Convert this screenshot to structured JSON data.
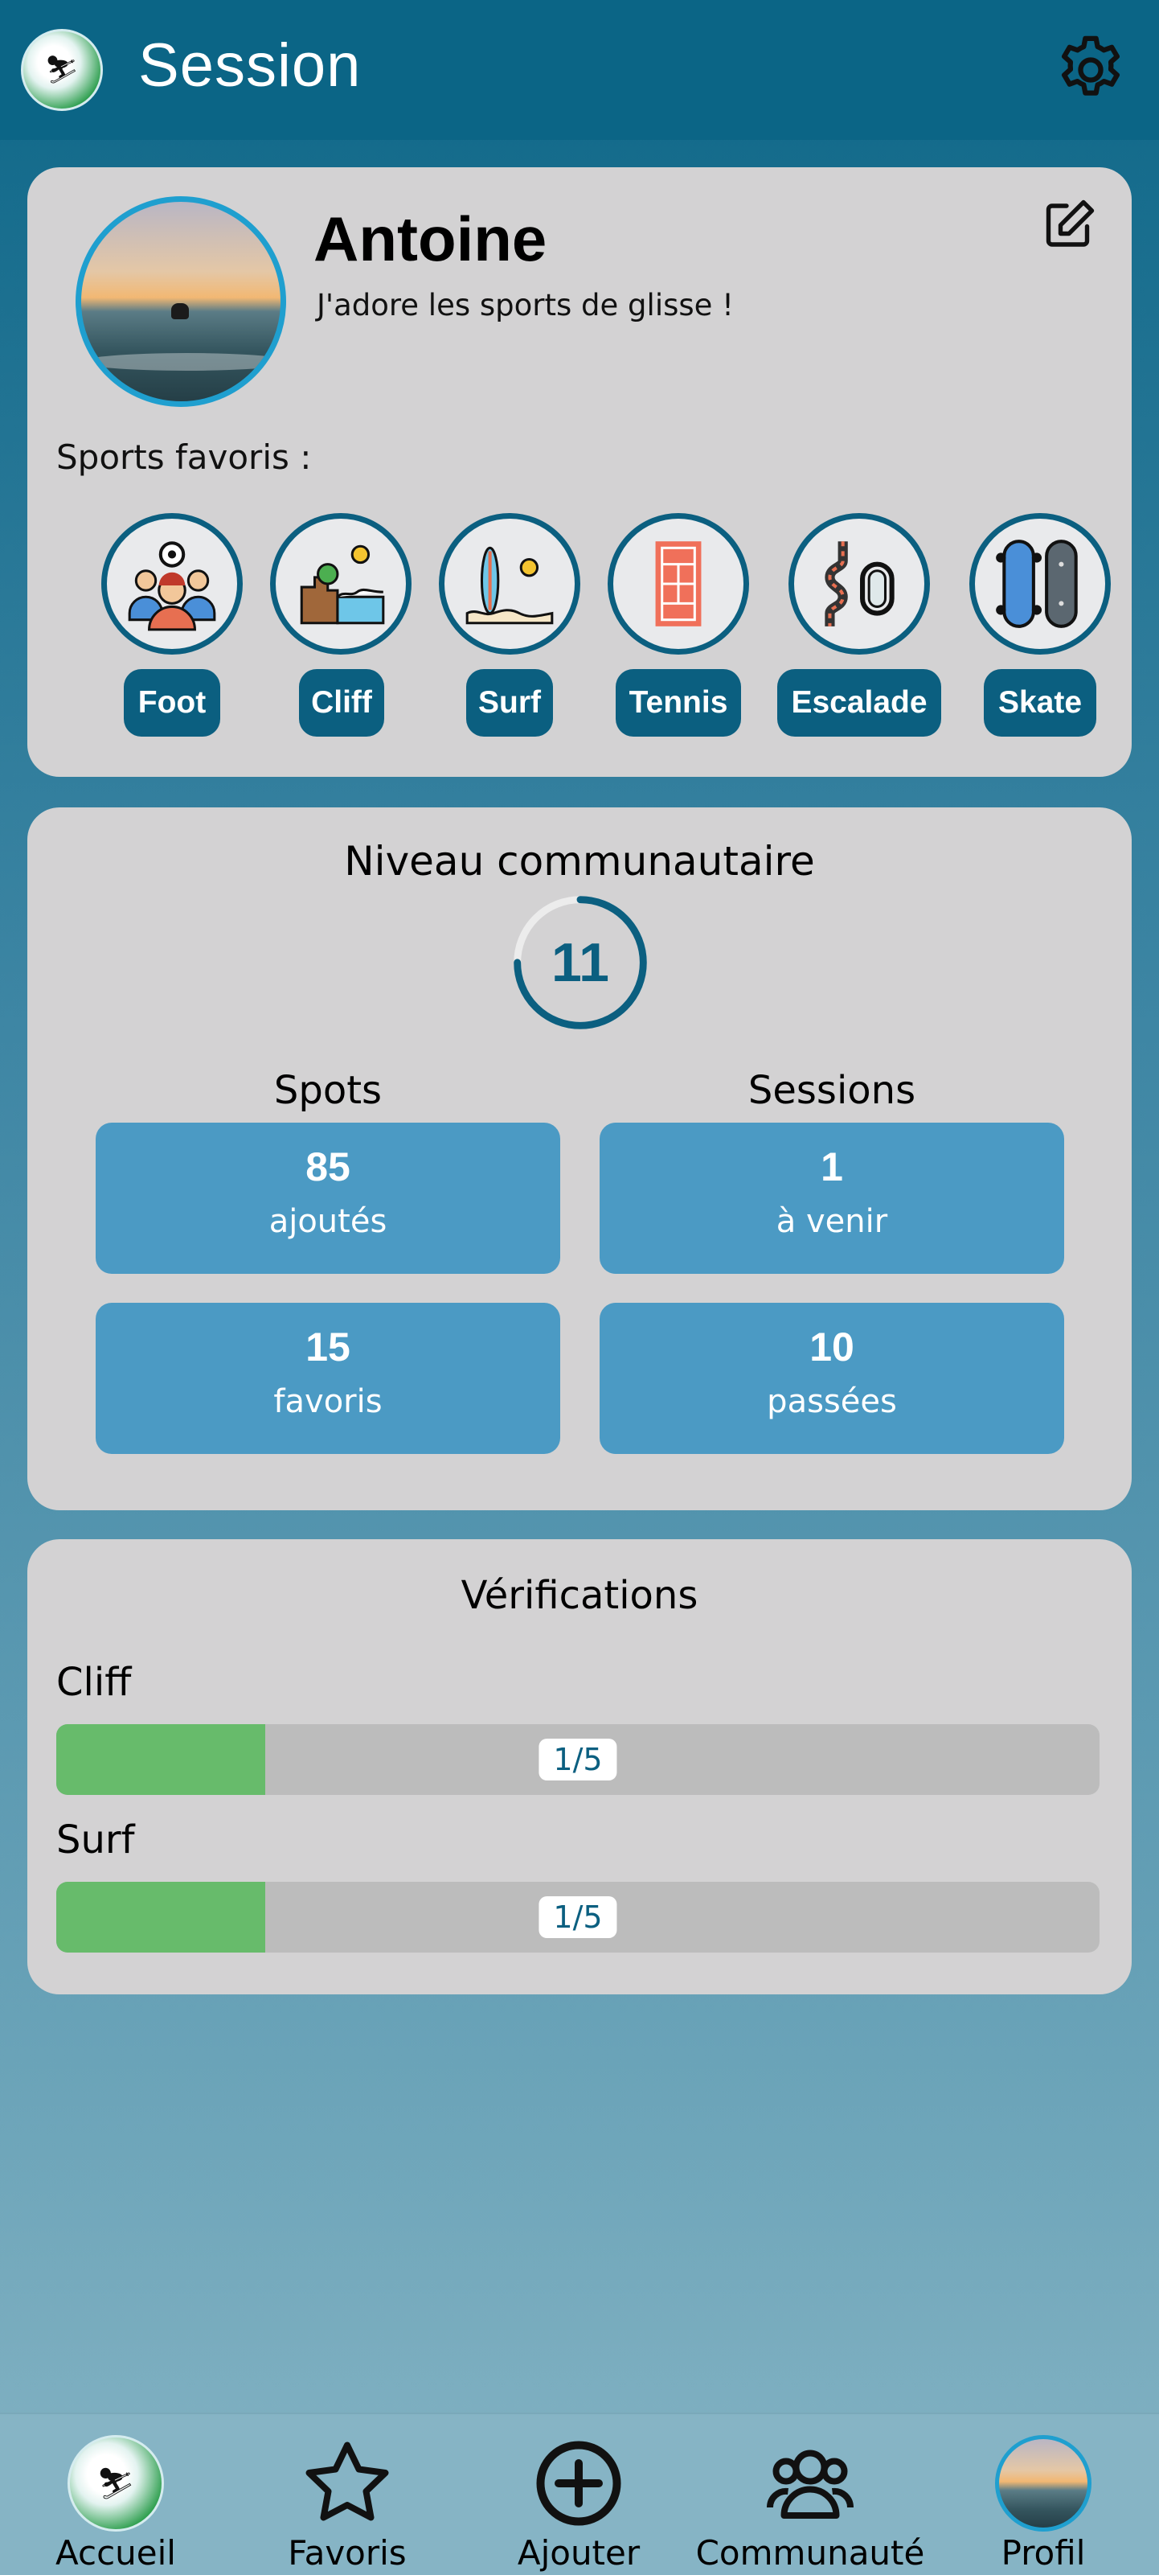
{
  "header": {
    "title": "Session",
    "logo_icon": "app-logo-icon",
    "settings_icon": "gear-icon"
  },
  "profile": {
    "name": "Antoine",
    "bio": "J'adore les sports de glisse !",
    "edit_icon": "edit-icon",
    "favorites_label": "Sports favoris :",
    "sports": [
      {
        "label": "Foot",
        "icon": "football-team-icon"
      },
      {
        "label": "Cliff",
        "icon": "cliff-diving-icon"
      },
      {
        "label": "Surf",
        "icon": "surfboard-icon"
      },
      {
        "label": "Tennis",
        "icon": "tennis-court-icon"
      },
      {
        "label": "Escalade",
        "icon": "climbing-carabiner-icon"
      },
      {
        "label": "Skate",
        "icon": "skateboard-icon"
      }
    ]
  },
  "community": {
    "title": "Niveau communautaire",
    "level": "11",
    "level_progress": 0.75,
    "spots_title": "Spots",
    "sessions_title": "Sessions",
    "stats": [
      {
        "value": "85",
        "label": "ajoutés"
      },
      {
        "value": "1",
        "label": "à venir"
      },
      {
        "value": "15",
        "label": "favoris"
      },
      {
        "value": "10",
        "label": "passées"
      }
    ]
  },
  "verifications": {
    "title": "Vérifications",
    "items": [
      {
        "name": "Cliff",
        "progress_text": "1/5",
        "fraction": 0.2
      },
      {
        "name": "Surf",
        "progress_text": "1/5",
        "fraction": 0.2
      }
    ]
  },
  "nav": {
    "items": [
      {
        "label": "Accueil",
        "icon": "app-logo-icon"
      },
      {
        "label": "Favoris",
        "icon": "star-icon"
      },
      {
        "label": "Ajouter",
        "icon": "plus-circle-icon"
      },
      {
        "label": "Communauté",
        "icon": "users-icon"
      },
      {
        "label": "Profil",
        "icon": "avatar"
      }
    ]
  },
  "colors": {
    "header_bg": "#0b6586",
    "card_bg": "#d3d2d3",
    "accent": "#0b5f80",
    "stat_bg": "#4b9ac4",
    "progress_fill": "#67bb6b"
  }
}
